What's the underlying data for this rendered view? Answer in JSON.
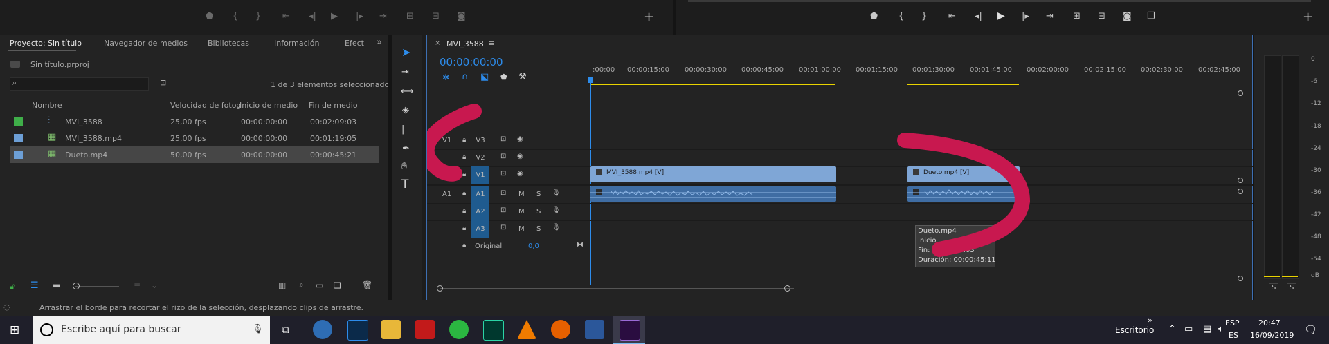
{
  "project_panel": {
    "tabs": [
      "Proyecto: Sin título",
      "Navegador de medios",
      "Bibliotecas",
      "Información",
      "Efect"
    ],
    "project_file": "Sin título.prproj",
    "search_placeholder": "",
    "selection_count": "1 de 3 elementos seleccionados",
    "columns": [
      "Nombre",
      "Velocidad de fotog",
      "Inicio de medio",
      "Fin de medio"
    ],
    "items": [
      {
        "name": "MVI_3588",
        "fps": "25,00 fps",
        "start": "00:00:00:00",
        "end": "00:02:09:03",
        "color": "#3fae49",
        "icon": "sequence-icon"
      },
      {
        "name": "MVI_3588.mp4",
        "fps": "25,00 fps",
        "start": "00:00:00:00",
        "end": "00:01:19:05",
        "color": "#6d9fd6",
        "icon": "video-clip-icon"
      },
      {
        "name": "Dueto.mp4",
        "fps": "50,00 fps",
        "start": "00:00:00:00",
        "end": "00:00:45:21",
        "color": "#6d9fd6",
        "icon": "video-clip-icon"
      }
    ]
  },
  "timeline": {
    "sequence_name": "MVI_3588",
    "timecode": "00:00:00:00",
    "ruler": [
      ":00:00",
      "00:00:15:00",
      "00:00:30:00",
      "00:00:45:00",
      "00:01:00:00",
      "00:01:15:00",
      "00:01:30:00",
      "00:01:45:00",
      "00:02:00:00",
      "00:02:15:00",
      "00:02:30:00",
      "00:02:45:00"
    ],
    "video_tracks": [
      {
        "source": "V1",
        "name": "V3"
      },
      {
        "source": "",
        "name": "V2"
      },
      {
        "source": "",
        "name": "V1"
      }
    ],
    "audio_tracks": [
      {
        "source": "A1",
        "name": "A1"
      },
      {
        "source": "",
        "name": "A2"
      },
      {
        "source": "",
        "name": "A3"
      }
    ],
    "mute_label": "M",
    "solo_label": "S",
    "original_label": "Original",
    "original_value": "0,0",
    "clips": [
      {
        "label": "MVI_3588.mp4 [V]"
      },
      {
        "label": "Dueto.mp4 [V]"
      }
    ],
    "tooltip": {
      "name": "Dueto.mp4",
      "start": "Inicio",
      "end": "Fin: 00:02:09:03",
      "duration": "Duración: 00:00:45:11"
    }
  },
  "meter": {
    "scale": [
      "0",
      "-6",
      "-12",
      "-18",
      "-24",
      "-30",
      "-36",
      "-42",
      "-48",
      "-54",
      "dB"
    ],
    "buttons": [
      "S",
      "S"
    ]
  },
  "status_bar": {
    "message": "Arrastrar el borde para recortar el rizo de la selección, desplazando clips de arrastre."
  },
  "taskbar": {
    "search_placeholder": "Escribe aquí para buscar",
    "desktop_label": "Escritorio",
    "lang_top": "ESP",
    "lang_bottom": "ES",
    "time": "20:47",
    "date": "16/09/2019"
  },
  "colors": {
    "accent_blue": "#2d8ceb",
    "clip_blue": "#7fa6d6",
    "work_area_yellow": "#e8d200",
    "annotation_red": "#c8184f"
  }
}
